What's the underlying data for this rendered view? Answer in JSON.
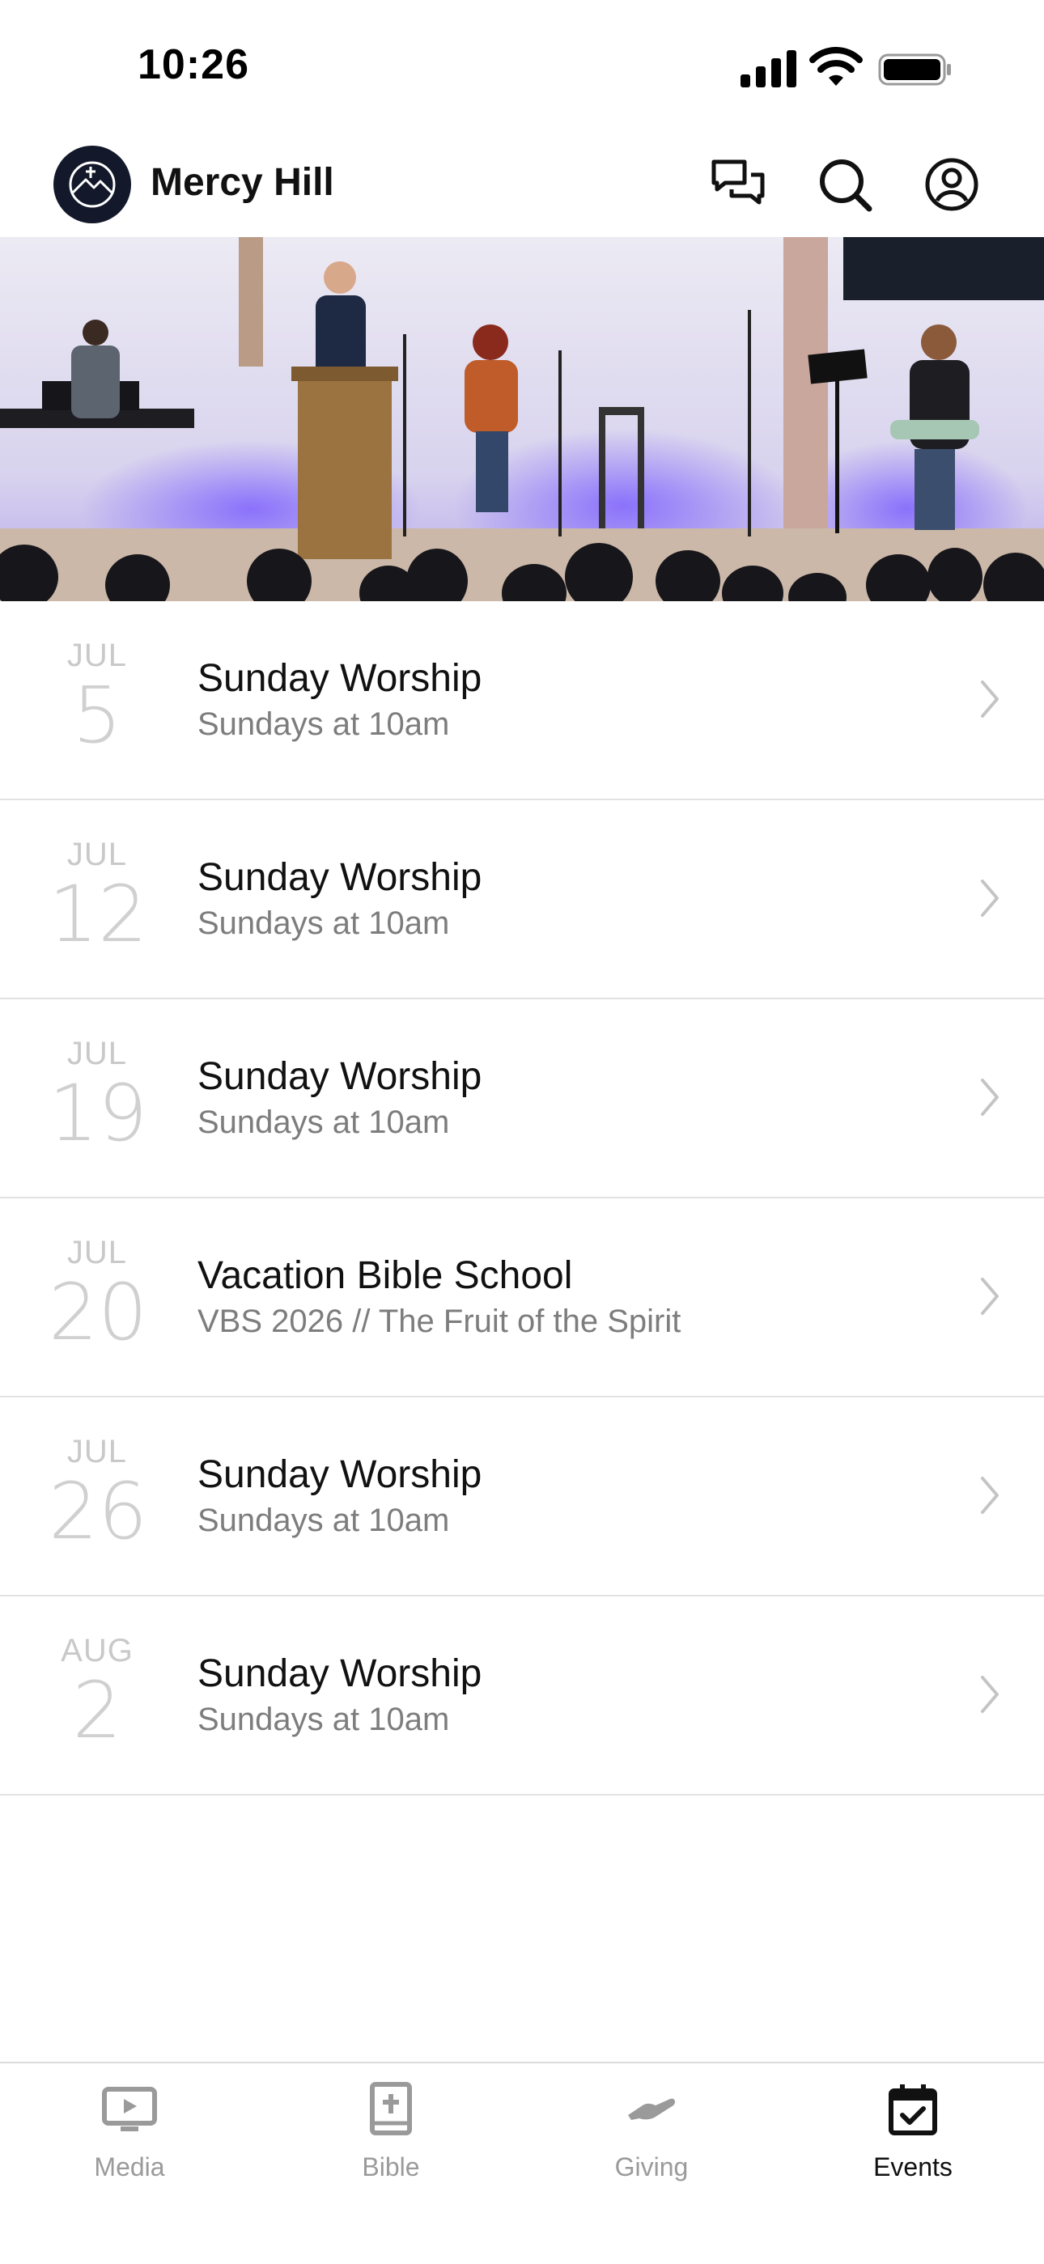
{
  "status_bar": {
    "time": "10:26"
  },
  "header": {
    "title": "Mercy Hill"
  },
  "events": [
    {
      "month": "JUL",
      "day": "5",
      "title": "Sunday Worship",
      "subtitle": "Sundays at 10am"
    },
    {
      "month": "JUL",
      "day": "12",
      "title": "Sunday Worship",
      "subtitle": "Sundays at 10am"
    },
    {
      "month": "JUL",
      "day": "19",
      "title": "Sunday Worship",
      "subtitle": "Sundays at 10am"
    },
    {
      "month": "JUL",
      "day": "20",
      "title": "Vacation Bible School",
      "subtitle": "VBS 2026 // The Fruit of the Spirit"
    },
    {
      "month": "JUL",
      "day": "26",
      "title": "Sunday Worship",
      "subtitle": "Sundays at 10am"
    },
    {
      "month": "AUG",
      "day": "2",
      "title": "Sunday Worship",
      "subtitle": "Sundays at 10am"
    }
  ],
  "tabs": [
    {
      "label": "Media",
      "icon": "media-icon",
      "active": false
    },
    {
      "label": "Bible",
      "icon": "bible-icon",
      "active": false
    },
    {
      "label": "Giving",
      "icon": "giving-icon",
      "active": false
    },
    {
      "label": "Events",
      "icon": "calendar-icon",
      "active": true
    }
  ],
  "colors": {
    "logo_bg": "#13192a",
    "muted_text": "#7d7d7d",
    "date_text": "#d0d0d0"
  }
}
